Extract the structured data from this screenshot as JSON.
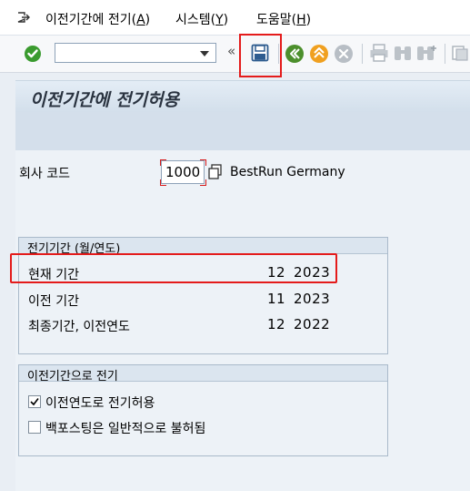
{
  "menu": {
    "items": [
      {
        "text": "이전기간에 전기(",
        "key": "A",
        "close": ")"
      },
      {
        "text": "시스템(",
        "key": "Y",
        "close": ")"
      },
      {
        "text": "도움말(",
        "key": "H",
        "close": ")"
      }
    ]
  },
  "toolbar": {
    "command_value": "",
    "icons": [
      "enter-icon",
      "save-icon",
      "back-icon",
      "exit-icon",
      "cancel-icon",
      "print-icon",
      "find-icon",
      "find-next-icon",
      "new-session-icon"
    ]
  },
  "page": {
    "title": "이전기간에 전기허용",
    "company_code_label": "회사 코드",
    "company_code_value": "1000",
    "company_name": "BestRun Germany"
  },
  "periods_group": {
    "header": "전기기간 (월/연도)",
    "rows": [
      {
        "label": "현재 기간",
        "month": "12",
        "year": "2023"
      },
      {
        "label": "이전 기간",
        "month": "11",
        "year": "2023"
      },
      {
        "label": "최종기간, 이전연도",
        "month": "12",
        "year": "2022"
      }
    ]
  },
  "posting_group": {
    "header": "이전기간으로 전기",
    "options": [
      {
        "label": "이전연도로 전기허용",
        "checked": true
      },
      {
        "label": "백포스팅은 일반적으로 불허됨",
        "checked": false
      }
    ]
  },
  "colors": {
    "highlight": "#e41b1b",
    "enter_green": "#3a9b2f",
    "back_green": "#4c8f2c",
    "exit_orange": "#f0a020",
    "cancel_gray": "#b8bec5",
    "save_blue": "#2e5c8f"
  }
}
